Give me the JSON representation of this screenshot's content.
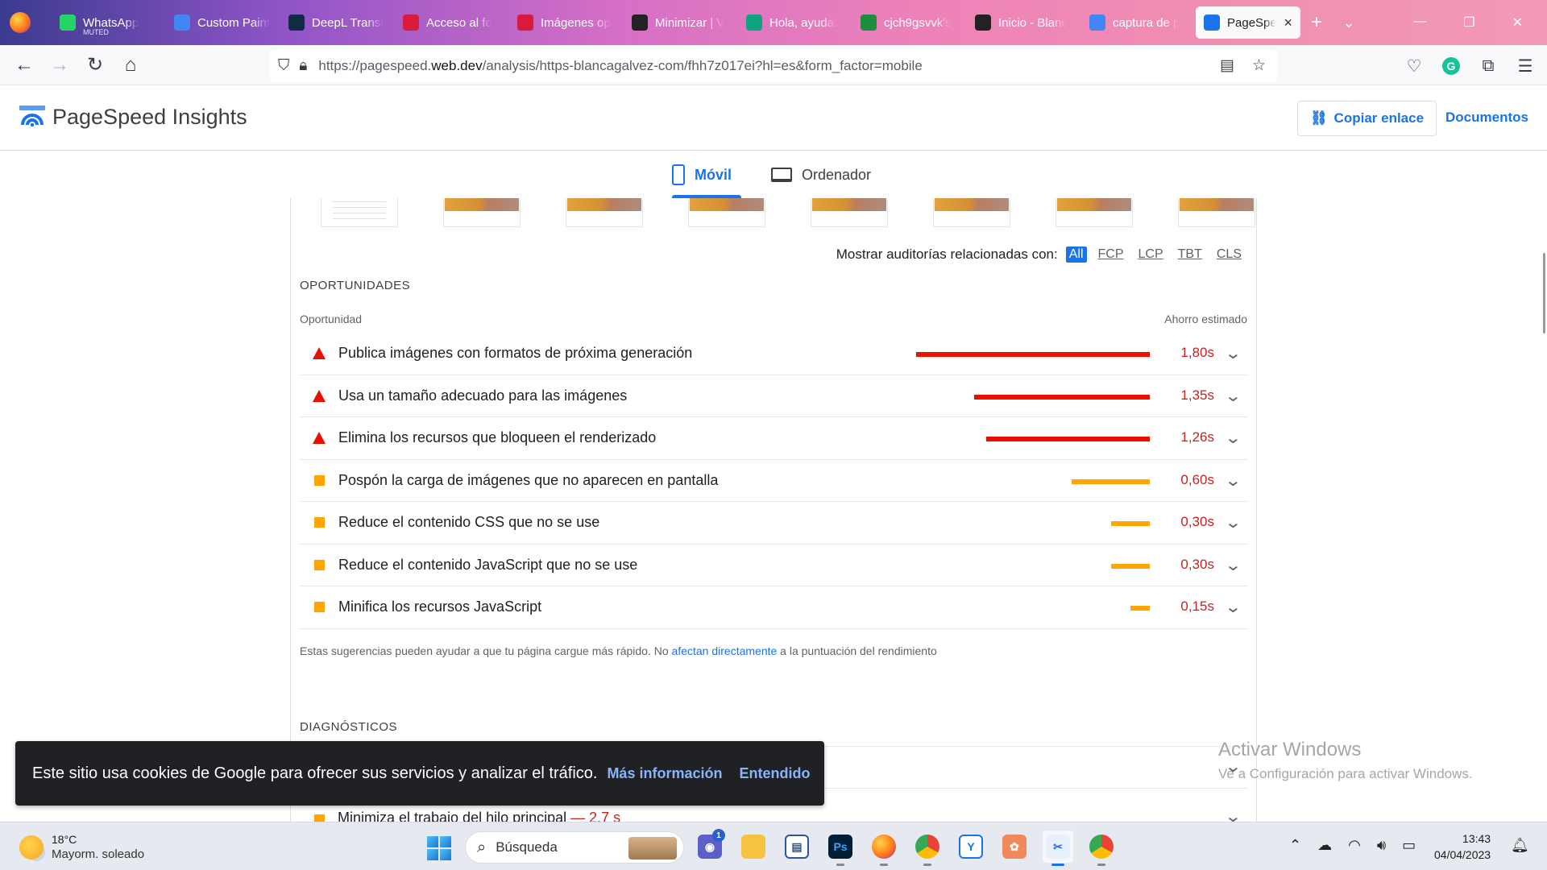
{
  "browser": {
    "tabs": [
      {
        "label": "WhatsApp",
        "sub": "MUTED",
        "icon": "whatsapp-icon",
        "color": "#25d366"
      },
      {
        "label": "Custom Paint",
        "icon": "docs-icon",
        "color": "#4285f4"
      },
      {
        "label": "DeepL Transl",
        "icon": "deepl-icon",
        "color": "#0f2b46"
      },
      {
        "label": "Acceso al fo",
        "icon": "u-icon",
        "color": "#d81b3a"
      },
      {
        "label": "Imágenes op",
        "icon": "u-red-icon",
        "color": "#d81b3a"
      },
      {
        "label": "Minimizar | V",
        "icon": "bird-icon",
        "color": "#222222"
      },
      {
        "label": "Hola, ayuda!",
        "icon": "chatgpt-icon",
        "color": "#10a37f"
      },
      {
        "label": "cjch9gsvvk's",
        "icon": "green-box-icon",
        "color": "#1e8e3e"
      },
      {
        "label": "Inicio - Blanc",
        "icon": "bird-icon",
        "color": "#222222"
      },
      {
        "label": "captura de p",
        "icon": "google-icon",
        "color": "#4285f4"
      },
      {
        "label": "PageSpee",
        "icon": "pagespeed-icon",
        "color": "#1a73e8",
        "active": true
      }
    ],
    "url_prefix": "https://pagespeed.",
    "url_domain": "web.dev",
    "url_rest": "/analysis/https-blancagalvez-com/fhh7z017ei?hl=es&form_factor=mobile"
  },
  "psi": {
    "title": "PageSpeed Insights",
    "copy_label": "Copiar enlace",
    "docs_label": "Documentos",
    "tab_mobile": "Móvil",
    "tab_desktop": "Ordenador"
  },
  "filter": {
    "label": "Mostrar auditorías relacionadas con:",
    "chips": [
      "All",
      "FCP",
      "LCP",
      "TBT",
      "CLS"
    ]
  },
  "opportunities": {
    "section": "OPORTUNIDADES",
    "col_left": "Oportunidad",
    "col_right": "Ahorro estimado",
    "items": [
      {
        "title": "Publica imágenes con formatos de próxima generación",
        "savings": "1,80s",
        "seconds": 1.8,
        "severity": "fail"
      },
      {
        "title": "Usa un tamaño adecuado para las imágenes",
        "savings": "1,35s",
        "seconds": 1.35,
        "severity": "fail"
      },
      {
        "title": "Elimina los recursos que bloqueen el renderizado",
        "savings": "1,26s",
        "seconds": 1.26,
        "severity": "fail"
      },
      {
        "title": "Pospón la carga de imágenes que no aparecen en pantalla",
        "savings": "0,60s",
        "seconds": 0.6,
        "severity": "average"
      },
      {
        "title": "Reduce el contenido CSS que no se use",
        "savings": "0,30s",
        "seconds": 0.3,
        "severity": "average"
      },
      {
        "title": "Reduce el contenido JavaScript que no se use",
        "savings": "0,30s",
        "seconds": 0.3,
        "severity": "average"
      },
      {
        "title": "Minifica los recursos JavaScript",
        "savings": "0,15s",
        "seconds": 0.15,
        "severity": "average"
      }
    ],
    "note_before": "Estas sugerencias pueden ayudar a que tu página cargue más rápido. No ",
    "note_link": "afectan directamente",
    "note_after": " a la puntuación del rendimiento"
  },
  "diagnostics": {
    "section": "DIAGNÓSTICOS",
    "row2_title": "Minimiza el trabajo del hilo principal",
    "row2_value": " — 2,7 s"
  },
  "cookie": {
    "text": "Este sitio usa cookies de Google para ofrecer sus servicios y analizar el tráfico.",
    "more": "Más información",
    "ok": "Entendido"
  },
  "watermark": {
    "line1": "Activar Windows",
    "line2": "Ve a Configuración para activar Windows."
  },
  "taskbar": {
    "temp": "18°C",
    "weather": "Mayorm. soleado",
    "search": "Búsqueda",
    "time": "13:43",
    "date": "04/04/2023",
    "chat_badge": "1"
  },
  "colors": {
    "fail": "#eb0f00",
    "average": "#ffa400",
    "accent": "#1a73e8"
  }
}
